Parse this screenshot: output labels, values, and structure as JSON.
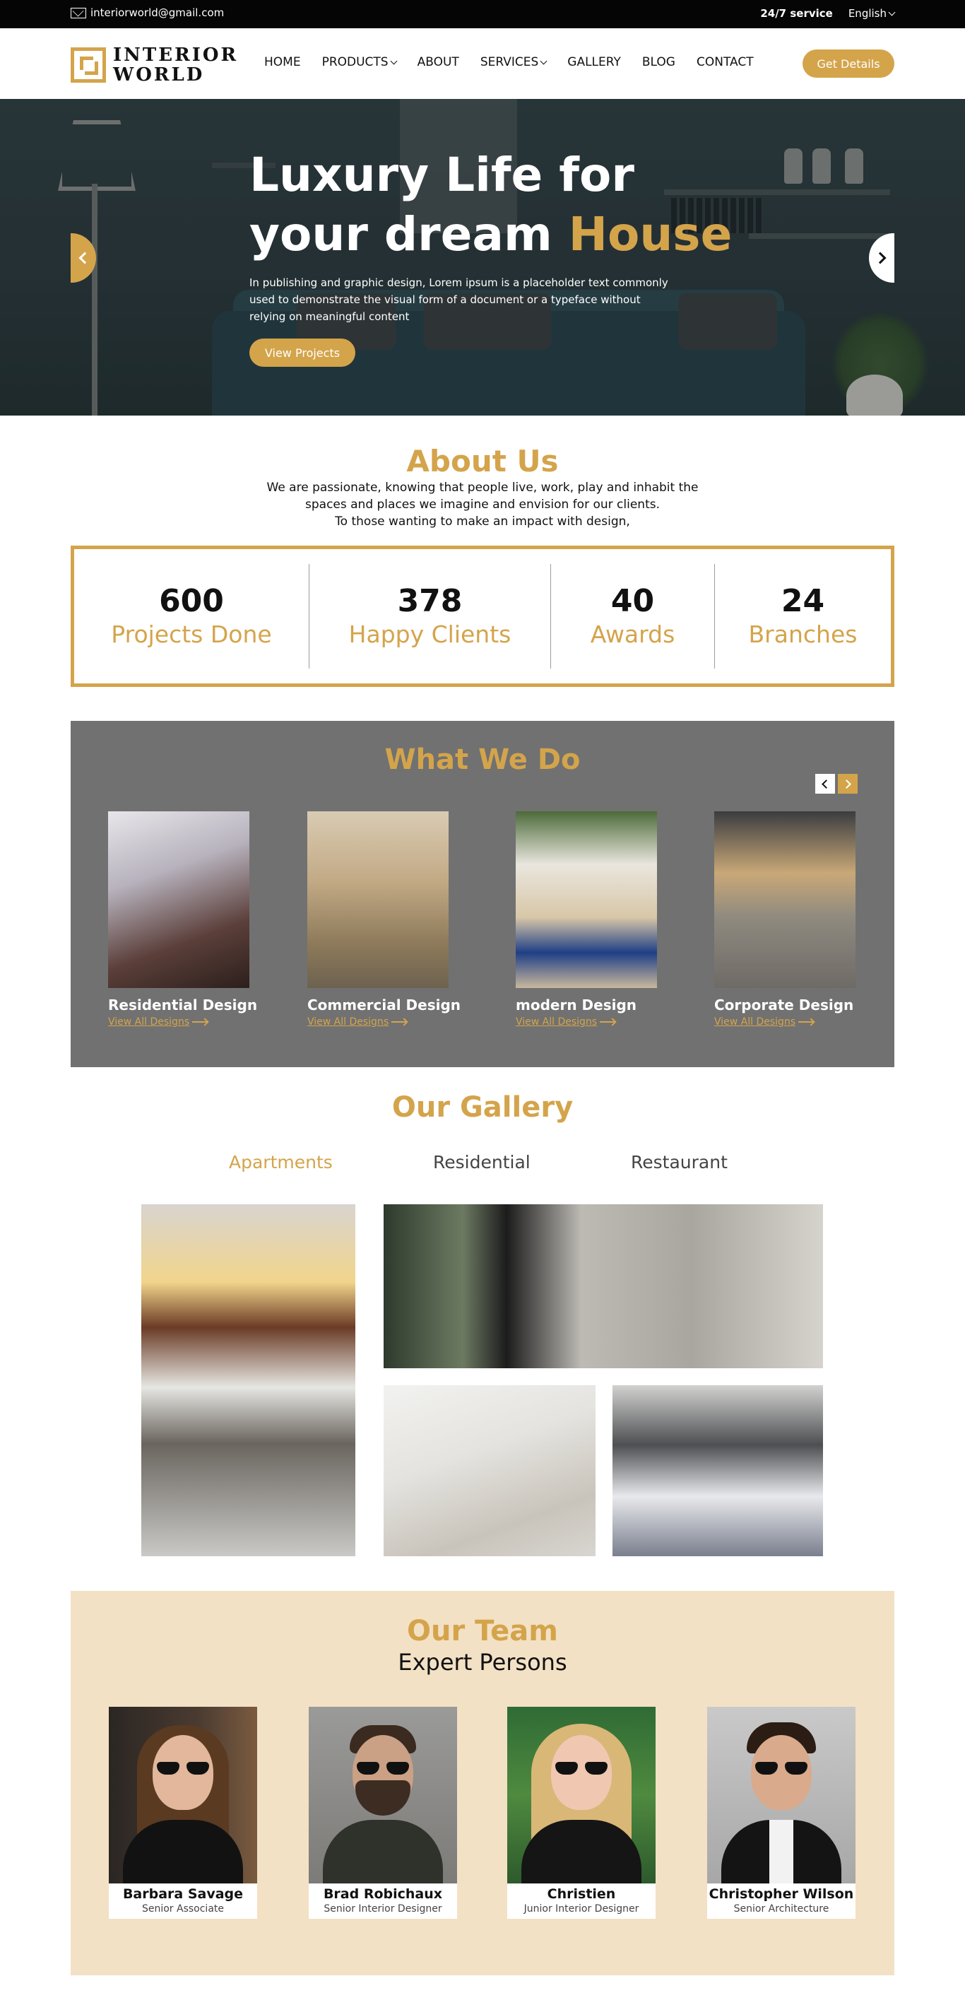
{
  "topbar": {
    "email": "interiorworld@gmail.com",
    "service": "24/7 service",
    "language": "English"
  },
  "brand": {
    "line1": "INTERIOR",
    "line2": "WORLD"
  },
  "nav": {
    "home": "HOME",
    "products": "PRODUCTS",
    "about": "ABOUT",
    "services": "SERVICES",
    "gallery": "GALLERY",
    "blog": "BLOG",
    "contact": "CONTACT"
  },
  "header": {
    "cta": "Get Details"
  },
  "hero": {
    "title_line1": "Luxury Life for",
    "title_line2_prefix": "your dream ",
    "title_line2_accent": "House",
    "text": "In publishing and graphic design, Lorem ipsum is a placeholder text commonly used to demonstrate the visual form of a document or a typeface without relying on meaningful content",
    "button": "View Projects"
  },
  "about": {
    "title": "About Us",
    "line1": "We are passionate, knowing that people live, work, play and inhabit the",
    "line2": "spaces and places we imagine and envision for our clients.",
    "line3": "To those wanting to make an impact with design,",
    "stats": [
      {
        "value": "600",
        "label": "Projects Done"
      },
      {
        "value": "378",
        "label": "Happy Clients"
      },
      {
        "value": "40",
        "label": "Awards"
      },
      {
        "value": "24",
        "label": "Branches"
      }
    ]
  },
  "what_we_do": {
    "title": "What We Do",
    "cards": [
      {
        "name": "Residential Design",
        "link": "View All Designs"
      },
      {
        "name": "Commercial Design",
        "link": "View All Designs"
      },
      {
        "name": "modern Design",
        "link": "View All Designs"
      },
      {
        "name": "Corporate Design",
        "link": "View All Designs"
      }
    ]
  },
  "gallery": {
    "title": "Our Gallery",
    "tabs": [
      "Apartments",
      "Residential",
      "Restaurant"
    ]
  },
  "team": {
    "title": "Our Team",
    "subtitle": "Expert Persons",
    "members": [
      {
        "name": "Barbara Savage",
        "role": "Senior Associate"
      },
      {
        "name": "Brad Robichaux",
        "role": "Senior Interior Designer"
      },
      {
        "name": "Christien",
        "role": "Junior Interior Designer"
      },
      {
        "name": "Christopher Wilson",
        "role": "Senior Architecture"
      }
    ]
  },
  "colors": {
    "accent": "#d4a44b",
    "dark": "#050505",
    "panel": "#717171",
    "team_bg": "#f3e1c5"
  },
  "icons": [
    "mail-icon",
    "chevron-down-icon",
    "chevron-left-icon",
    "chevron-right-icon",
    "arrow-right-icon"
  ]
}
